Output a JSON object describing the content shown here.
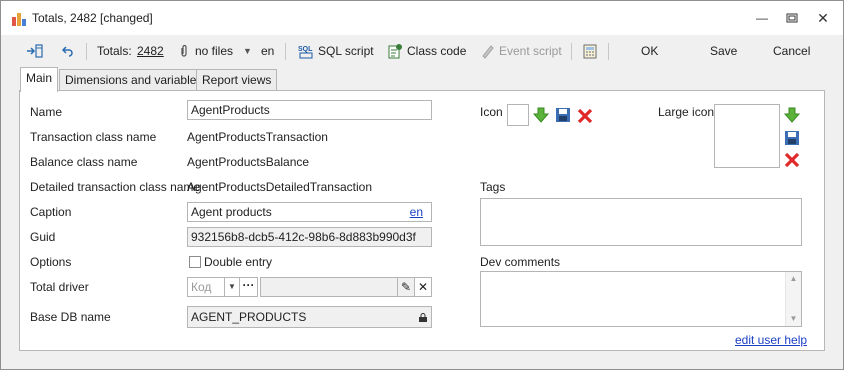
{
  "window": {
    "title": "Totals, 2482 [changed]"
  },
  "toolbar": {
    "totals_label": "Totals:",
    "totals_number": "2482",
    "files_label": "no files",
    "lang": "en",
    "sql_script": "SQL script",
    "class_code": "Class code",
    "event_script": "Event script",
    "ok": "OK",
    "save": "Save",
    "cancel": "Cancel"
  },
  "tabs": [
    "Main",
    "Dimensions and variables",
    "Report views"
  ],
  "form": {
    "name_label": "Name",
    "name_value": "AgentProducts",
    "transaction_label": "Transaction class name",
    "transaction_value": "AgentProductsTransaction",
    "balance_label": "Balance class name",
    "balance_value": "AgentProductsBalance",
    "detailed_label": "Detailed transaction class name",
    "detailed_value": "AgentProductsDetailedTransaction",
    "caption_label": "Caption",
    "caption_value": "Agent products",
    "caption_lang": "en",
    "guid_label": "Guid",
    "guid_value": "932156b8-dcb5-412c-98b6-8d883b990d3f",
    "options_label": "Options",
    "double_entry": "Double entry",
    "driver_label": "Total driver",
    "driver_placeholder": "Код",
    "basedb_label": "Base DB name",
    "basedb_value": "AGENT_PRODUCTS",
    "icon_label": "Icon",
    "large_icon_label": "Large icon",
    "tags_label": "Tags",
    "dev_comments_label": "Dev comments",
    "edit_user_help": "edit user help"
  }
}
